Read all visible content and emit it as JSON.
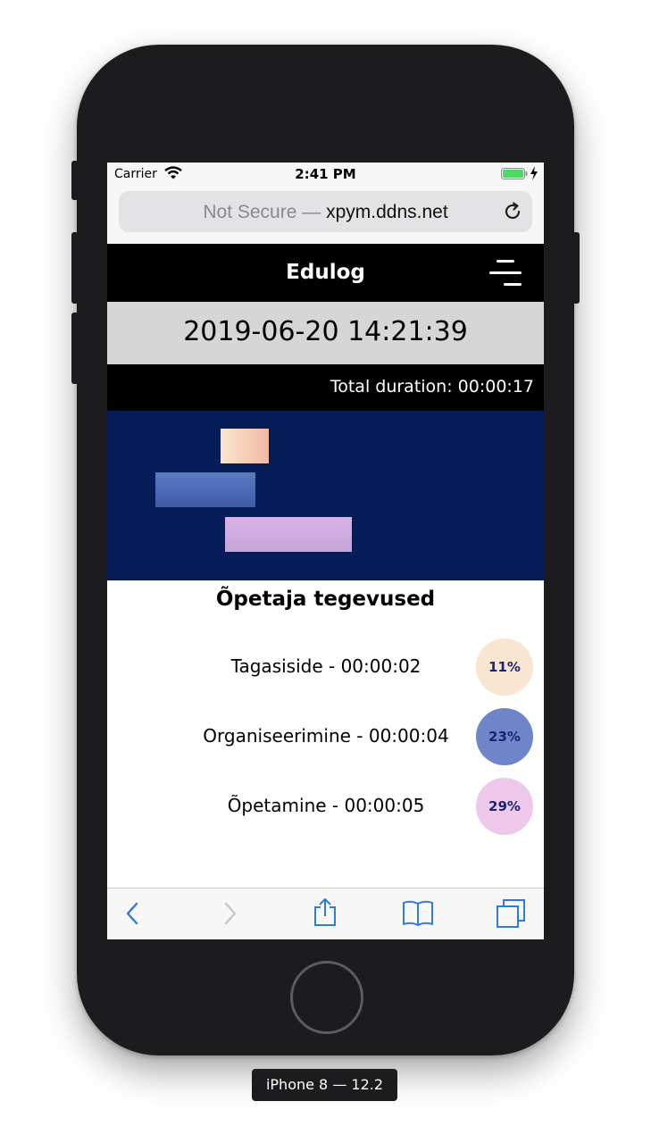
{
  "status_bar": {
    "carrier": "Carrier",
    "time": "2:41 PM"
  },
  "browser": {
    "security": "Not Secure —",
    "domain": "xpym.ddns.net"
  },
  "app": {
    "title": "Edulog"
  },
  "session": {
    "datetime": "2019-06-20 14:21:39",
    "total_duration": "Total duration: 00:00:17"
  },
  "section": {
    "title": "Õpetaja tegevused"
  },
  "activities": [
    {
      "label": "Tagasiside - 00:00:02",
      "percent": "11%",
      "color": "#f9e6d0"
    },
    {
      "label": "Organiseerimine - 00:00:04",
      "percent": "23%",
      "color": "#6e86c9"
    },
    {
      "label": "Õpetamine - 00:00:05",
      "percent": "29%",
      "color": "#eec8ea"
    }
  ],
  "colors": {
    "timeline_bg": "#061c56",
    "app_bar": "#000000",
    "accent_blue": "#2f7bd8"
  },
  "device": {
    "label": "iPhone 8 — 12.2"
  }
}
